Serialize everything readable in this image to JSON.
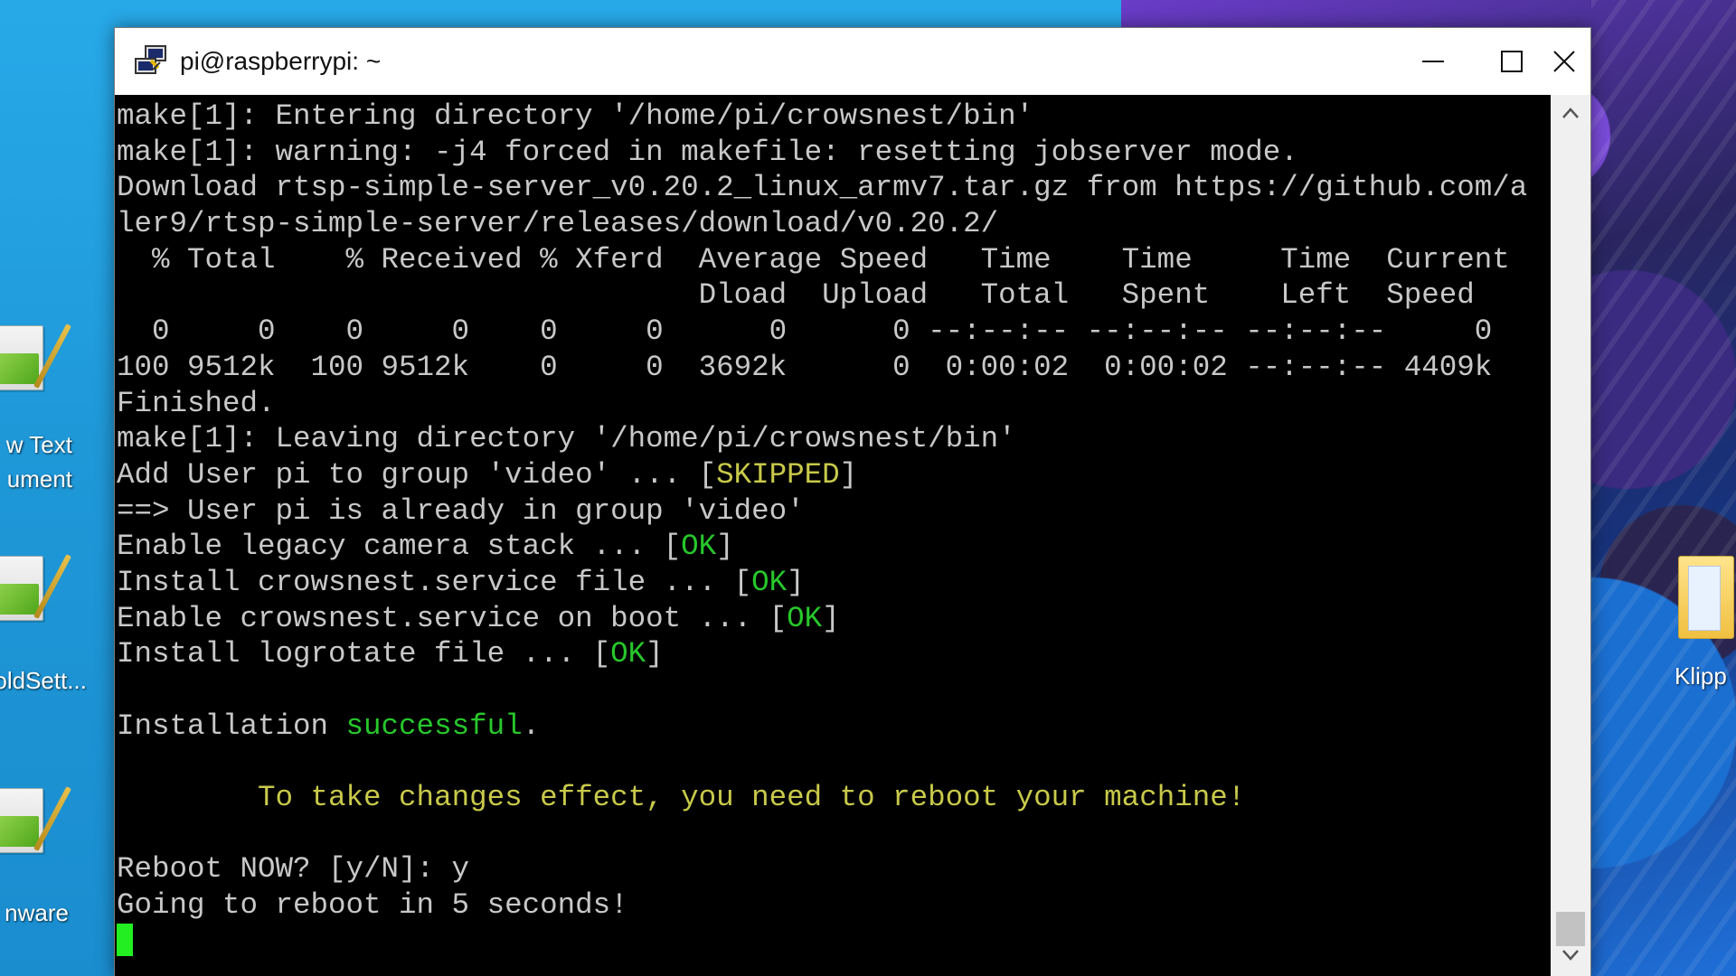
{
  "window": {
    "title": "pi@raspberrypi: ~",
    "icon": "putty-icon",
    "controls": [
      "minimize-icon",
      "maximize-icon",
      "close-icon"
    ]
  },
  "desktop": {
    "icons": [
      {
        "label_line1": "w Text",
        "label_line2": "ument",
        "icon": "notepad-icon"
      },
      {
        "label_line1": "oldSett...",
        "label_line2": "",
        "icon": "notepad-icon"
      },
      {
        "label_line1": "nware",
        "label_line2": "",
        "icon": "notepad-icon"
      },
      {
        "label_line1": "Klipp",
        "label_line2": "",
        "icon": "folder-icon"
      }
    ]
  },
  "terminal": {
    "colors": {
      "text": "#c8c8c8",
      "ok": "#27c72b",
      "warn": "#c8c94a",
      "cursor": "#22ee22"
    },
    "lines": [
      {
        "segments": [
          {
            "text": "make[1]: Entering directory '/home/pi/crowsnest/bin'"
          }
        ]
      },
      {
        "segments": [
          {
            "text": "make[1]: warning: -j4 forced in makefile: resetting jobserver mode."
          }
        ]
      },
      {
        "segments": [
          {
            "text": "Download rtsp-simple-server_v0.20.2_linux_armv7.tar.gz from https://github.com/a"
          }
        ]
      },
      {
        "segments": [
          {
            "text": "ler9/rtsp-simple-server/releases/download/v0.20.2/"
          }
        ]
      },
      {
        "segments": [
          {
            "text": "  % Total    % Received % Xferd  Average Speed   Time    Time     Time  Current"
          }
        ]
      },
      {
        "segments": [
          {
            "text": "                                 Dload  Upload   Total   Spent    Left  Speed"
          }
        ]
      },
      {
        "segments": [
          {
            "text": "  0     0    0     0    0     0      0      0 --:--:-- --:--:-- --:--:--     0"
          }
        ]
      },
      {
        "segments": [
          {
            "text": "100 9512k  100 9512k    0     0  3692k      0  0:00:02  0:00:02 --:--:-- 4409k"
          }
        ]
      },
      {
        "segments": [
          {
            "text": "Finished."
          }
        ]
      },
      {
        "segments": [
          {
            "text": "make[1]: Leaving directory '/home/pi/crowsnest/bin'"
          }
        ]
      },
      {
        "segments": [
          {
            "text": "Add User pi to group 'video' ... ["
          },
          {
            "text": "SKIPPED",
            "color": "warn"
          },
          {
            "text": "]"
          }
        ]
      },
      {
        "segments": [
          {
            "text": "==> User pi is already in group 'video'"
          }
        ]
      },
      {
        "segments": [
          {
            "text": "Enable legacy camera stack ... ["
          },
          {
            "text": "OK",
            "color": "ok"
          },
          {
            "text": "]"
          }
        ]
      },
      {
        "segments": [
          {
            "text": "Install crowsnest.service file ... ["
          },
          {
            "text": "OK",
            "color": "ok"
          },
          {
            "text": "]"
          }
        ]
      },
      {
        "segments": [
          {
            "text": "Enable crowsnest.service on boot ... ["
          },
          {
            "text": "OK",
            "color": "ok"
          },
          {
            "text": "]"
          }
        ]
      },
      {
        "segments": [
          {
            "text": "Install logrotate file ... ["
          },
          {
            "text": "OK",
            "color": "ok"
          },
          {
            "text": "]"
          }
        ]
      },
      {
        "segments": [
          {
            "text": ""
          }
        ]
      },
      {
        "segments": [
          {
            "text": "Installation "
          },
          {
            "text": "successful",
            "color": "ok"
          },
          {
            "text": "."
          }
        ]
      },
      {
        "segments": [
          {
            "text": ""
          }
        ]
      },
      {
        "segments": [
          {
            "text": "        "
          },
          {
            "text": "To take changes effect, you need to reboot your machine!",
            "color": "warn"
          }
        ]
      },
      {
        "segments": [
          {
            "text": ""
          }
        ]
      },
      {
        "segments": [
          {
            "text": "Reboot NOW? [y/N]: y"
          }
        ]
      },
      {
        "segments": [
          {
            "text": "Going to reboot in 5 seconds!"
          }
        ]
      }
    ],
    "cursor_visible": true
  },
  "scrollbar": {
    "up": "chevron-up-icon",
    "down": "chevron-down-icon",
    "position_fraction": 1.0
  }
}
